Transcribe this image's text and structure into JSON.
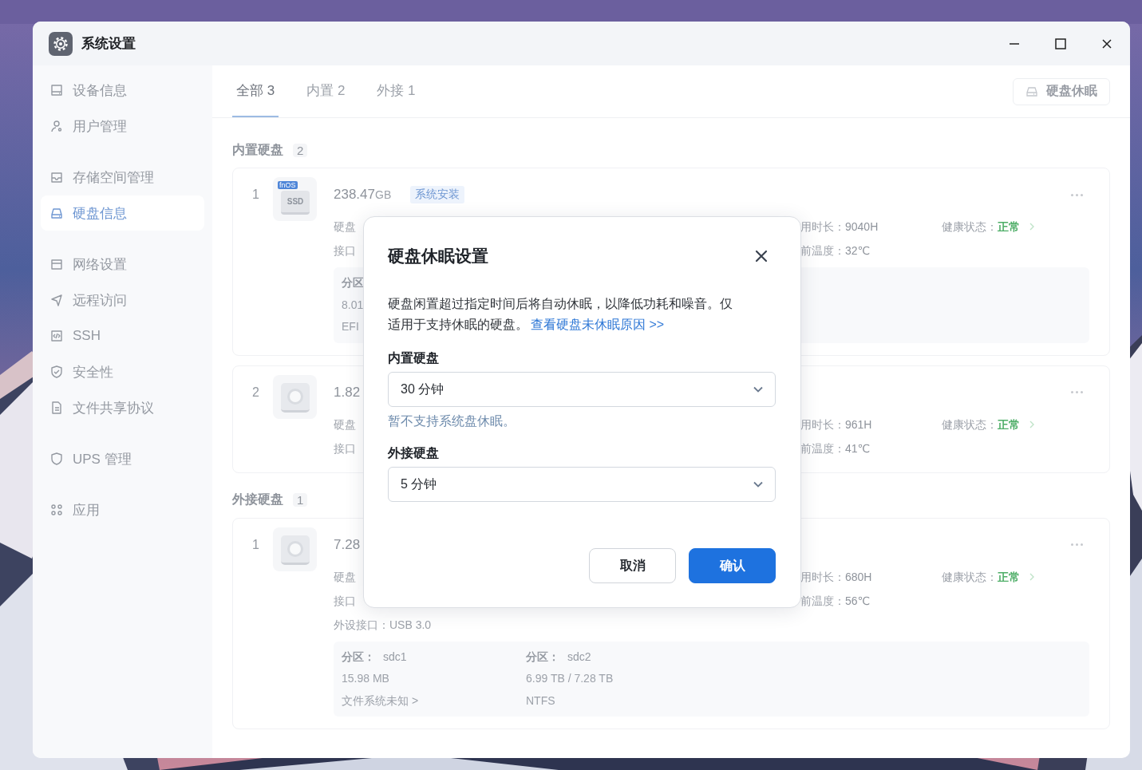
{
  "window": {
    "title": "系统设置"
  },
  "sidebar": {
    "groups": [
      {
        "items": [
          {
            "label": "设备信息",
            "selected": false
          },
          {
            "label": "用户管理",
            "selected": false
          }
        ]
      },
      {
        "items": [
          {
            "label": "存储空间管理",
            "selected": false
          },
          {
            "label": "硬盘信息",
            "selected": true
          }
        ]
      },
      {
        "items": [
          {
            "label": "网络设置",
            "selected": false
          },
          {
            "label": "远程访问",
            "selected": false
          },
          {
            "label": "SSH",
            "selected": false
          },
          {
            "label": "安全性",
            "selected": false
          },
          {
            "label": "文件共享协议",
            "selected": false
          }
        ]
      },
      {
        "items": [
          {
            "label": "UPS 管理",
            "selected": false
          }
        ]
      },
      {
        "items": [
          {
            "label": "应用",
            "selected": false
          }
        ]
      }
    ]
  },
  "tabs": [
    {
      "label": "全部 3",
      "selected": true
    },
    {
      "label": "内置 2",
      "selected": false
    },
    {
      "label": "外接 1",
      "selected": false
    }
  ],
  "sleep_button": "硬盘休眠",
  "sections": [
    {
      "title": "内置硬盘",
      "count": "2",
      "disks": [
        {
          "index": "1",
          "kind": "ssd",
          "icon_badge": "fnOS",
          "icon_label": "SSD",
          "size": "238.47",
          "unit": "GB",
          "tag": "系统安装",
          "lines": [
            "硬盘",
            "接口"
          ],
          "stats": [
            {
              "label": "用时长：",
              "value": "9040H"
            },
            {
              "label": "前温度：",
              "value": "32℃"
            }
          ],
          "health": {
            "label": "健康状态：",
            "value": "正常"
          },
          "partitions": [
            {
              "title": "分区",
              "lines": [
                "8.01",
                "EFI"
              ]
            }
          ]
        },
        {
          "index": "2",
          "kind": "hdd",
          "size": "1.82",
          "lines": [
            "硬盘",
            "接口"
          ],
          "stats": [
            {
              "label": "用时长：",
              "value": "961H"
            },
            {
              "label": "前温度：",
              "value": "41℃"
            }
          ],
          "health": {
            "label": "健康状态：",
            "value": "正常"
          }
        }
      ]
    },
    {
      "title": "外接硬盘",
      "count": "1",
      "disks": [
        {
          "index": "1",
          "kind": "hdd",
          "size": "7.28",
          "lines": [
            "硬盘",
            "接口",
            "外设接口：USB 3.0"
          ],
          "stats": [
            {
              "label": "用时长：",
              "value": "680H"
            },
            {
              "label": "前温度：",
              "value": "56℃"
            }
          ],
          "health": {
            "label": "健康状态：",
            "value": "正常"
          },
          "partitions": [
            {
              "title": "分区：",
              "name": "sdc1",
              "lines": [
                "15.98 MB",
                "文件系统未知 >"
              ]
            },
            {
              "title": "分区：",
              "name": "sdc2",
              "lines": [
                "6.99 TB / 7.28 TB",
                "NTFS"
              ]
            }
          ]
        }
      ]
    }
  ],
  "dialog": {
    "title": "硬盘休眠设置",
    "description": "硬盘闲置超过指定时间后将自动休眠，以降低功耗和噪音。仅适用于支持休眠的硬盘。",
    "link": "查看硬盘未休眠原因 >>",
    "fields": [
      {
        "label": "内置硬盘",
        "value": "30 分钟",
        "note": "暂不支持系统盘休眠。"
      },
      {
        "label": "外接硬盘",
        "value": "5 分钟"
      }
    ],
    "buttons": [
      {
        "label": "取消",
        "kind": "secondary"
      },
      {
        "label": "确认",
        "kind": "primary"
      }
    ]
  }
}
